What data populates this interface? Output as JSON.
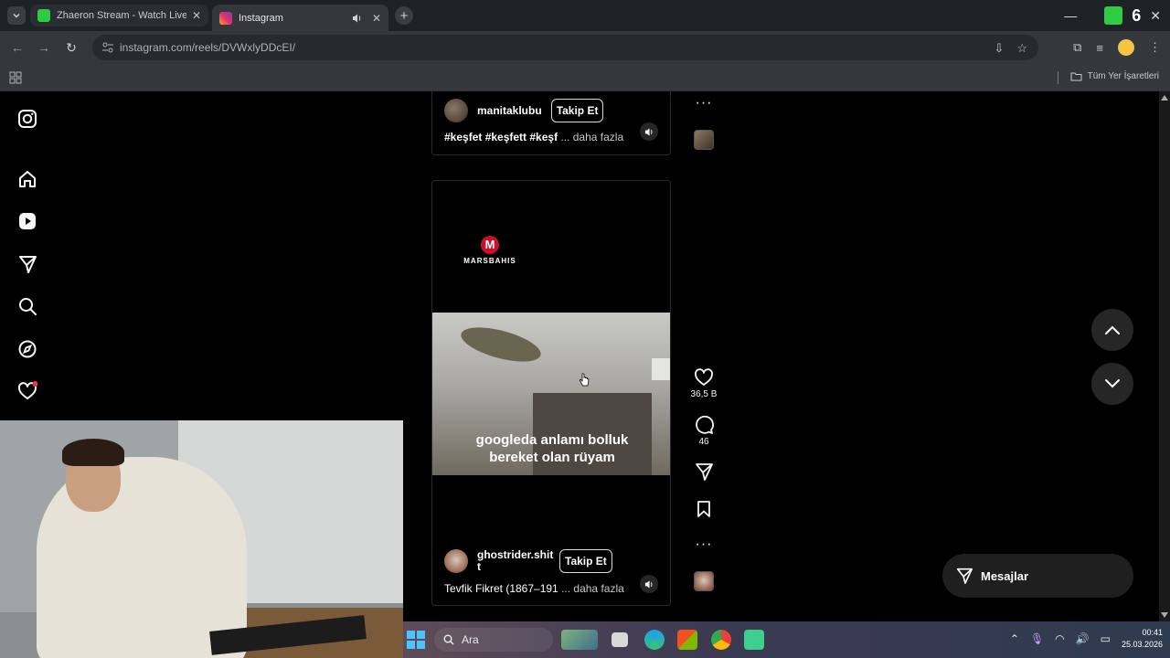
{
  "browser": {
    "tabs": [
      {
        "title": "Zhaeron Stream - Watch Live o",
        "active": false,
        "favicon_color": "#2ecc40"
      },
      {
        "title": "Instagram",
        "active": true,
        "favicon_color": "#e1306c"
      }
    ],
    "url": "instagram.com/reels/DVWxlyDDcEI/",
    "bookmarks_all_label": "Tüm Yer İşaretleri",
    "brand_counter": "6"
  },
  "sidebar": {
    "items": [
      "instagram-logo-icon",
      "home-icon",
      "reels-icon",
      "messages-icon",
      "search-icon",
      "explore-icon",
      "notifications-icon"
    ]
  },
  "reels": [
    {
      "username": "manitaklubu",
      "follow_label": "Takip Et",
      "caption": "#keşfet #keşfett #keşf",
      "more_label": "... daha fazla"
    },
    {
      "ad_brand": "MARSBAHIS",
      "ad_letter": "M",
      "video_caption_line1": "googleda anlamı bolluk",
      "video_caption_line2": "bereket olan rüyam",
      "username_line1": "ghostrider.shit",
      "username_line2": "t",
      "follow_label": "Takip Et",
      "caption": "Tevfik Fikret (1867–191",
      "more_label": "... daha fazla"
    }
  ],
  "actions": {
    "likes": "36,5 B",
    "comments": "46"
  },
  "messages_label": "Mesajlar",
  "taskbar": {
    "search_label": "Ara",
    "time": "00:41",
    "date": "25.03.2026"
  },
  "colors": {
    "accent_red": "#ff3040",
    "ad_red": "#c8102e"
  }
}
